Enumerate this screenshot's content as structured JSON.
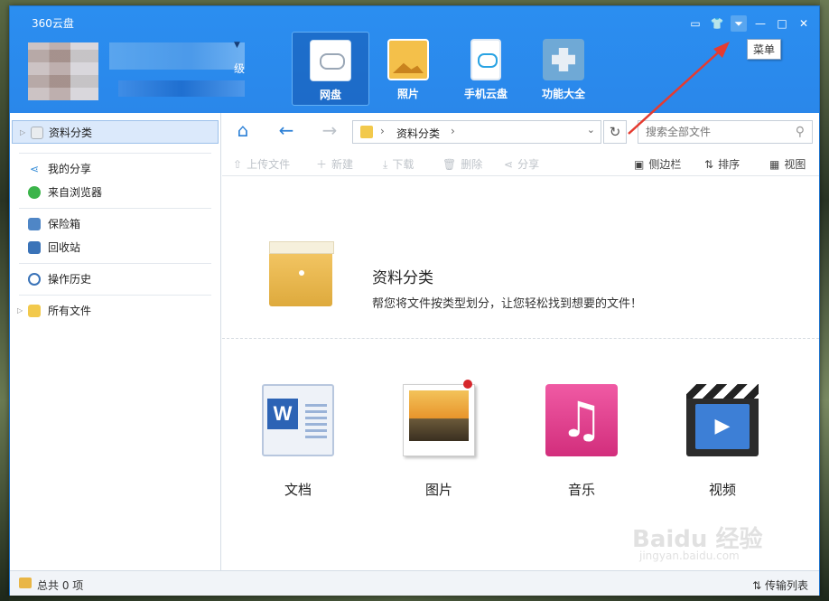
{
  "window": {
    "title": "360云盘"
  },
  "user": {
    "level_suffix": "级"
  },
  "nav_tabs": [
    {
      "label": "网盘",
      "icon": "cloud-disk-icon"
    },
    {
      "label": "照片",
      "icon": "photo-icon"
    },
    {
      "label": "手机云盘",
      "icon": "phone-cloud-icon"
    },
    {
      "label": "功能大全",
      "icon": "toolbox-icon"
    }
  ],
  "window_controls": {
    "menu_tooltip": "菜单"
  },
  "sidebar": {
    "items": [
      {
        "label": "资料分类"
      },
      {
        "label": "我的分享"
      },
      {
        "label": "来自浏览器"
      },
      {
        "label": "保险箱"
      },
      {
        "label": "回收站"
      },
      {
        "label": "操作历史"
      },
      {
        "label": "所有文件"
      }
    ]
  },
  "address": {
    "crumb": "资料分类"
  },
  "search": {
    "placeholder": "搜索全部文件"
  },
  "toolbar": {
    "upload": "上传文件",
    "new": "新建",
    "download": "下载",
    "delete": "删除",
    "share": "分享",
    "sidebar": "侧边栏",
    "sort": "排序",
    "view": "视图"
  },
  "hero": {
    "title": "资料分类",
    "subtitle": "帮您将文件按类型划分，让您轻松找到想要的文件！"
  },
  "categories": [
    {
      "label": "文档"
    },
    {
      "label": "图片"
    },
    {
      "label": "音乐"
    },
    {
      "label": "视频"
    }
  ],
  "status": {
    "total": "总共 0 项",
    "transfer": "传输列表"
  },
  "watermark": {
    "brand": "Baidu 经验",
    "url": "jingyan.baidu.com"
  },
  "colors": {
    "header_blue": "#2b8ef0",
    "active_side": "#dbe9fb"
  }
}
